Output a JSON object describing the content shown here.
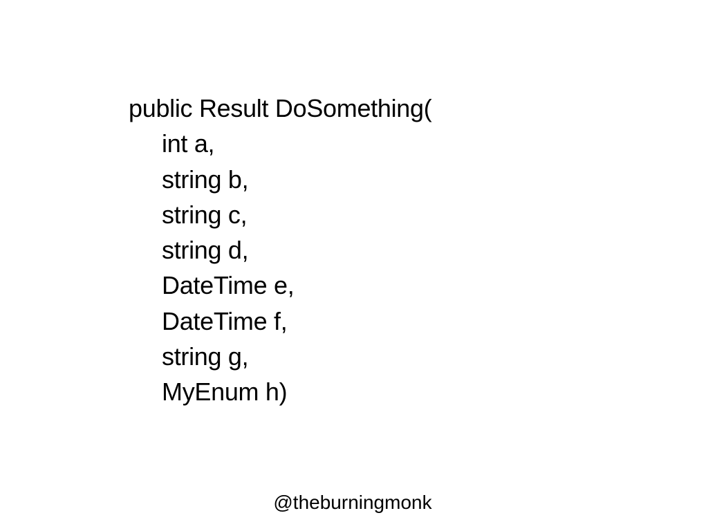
{
  "slide": {
    "code_lines": [
      "public Result DoSomething(",
      "int a,",
      "string b,",
      "string c,",
      "string d,",
      "DateTime e,",
      "DateTime f,",
      "string g,",
      "MyEnum h)"
    ],
    "handle": "@theburningmonk"
  }
}
